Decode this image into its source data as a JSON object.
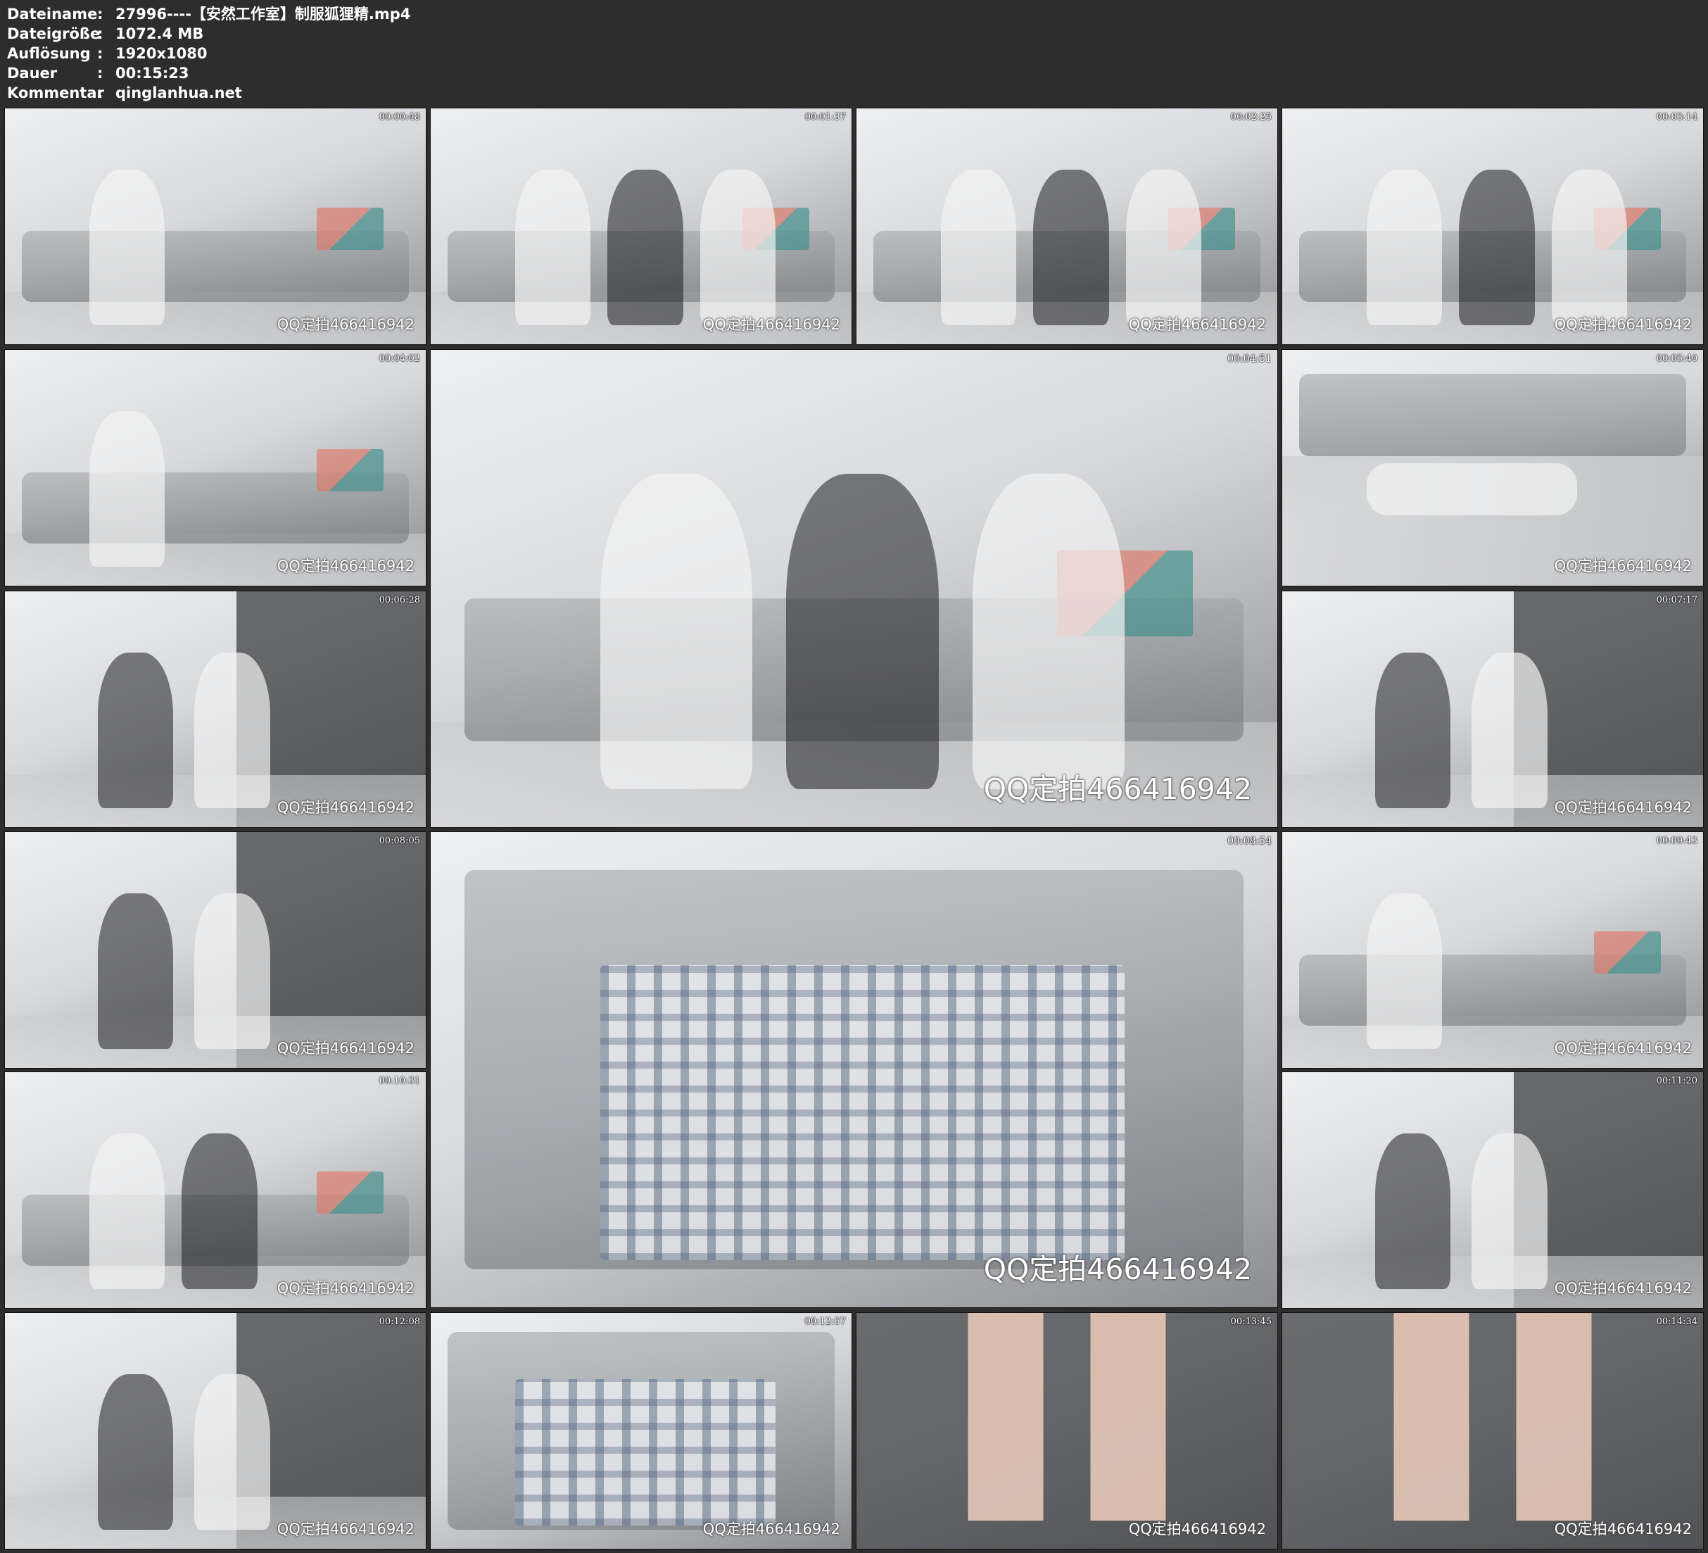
{
  "info": [
    {
      "label": "Dateiname",
      "value": "27996----【安然工作室】制服狐狸精.mp4"
    },
    {
      "label": "Dateigröße",
      "value": "1072.4 MB"
    },
    {
      "label": "Auflösung",
      "value": "1920x1080"
    },
    {
      "label": "Dauer",
      "value": "00:15:23"
    },
    {
      "label": "Kommentar",
      "value": "qinglanhua.net"
    }
  ],
  "separator": ":",
  "watermark": "QQ定拍466416942",
  "thumbnails": [
    {
      "timestamp": "00:00:48",
      "scene": "sofa-phone"
    },
    {
      "timestamp": "00:01:37",
      "scene": "sofa-three"
    },
    {
      "timestamp": "00:02:25",
      "scene": "sofa-three"
    },
    {
      "timestamp": "00:03:14",
      "scene": "sofa-three"
    },
    {
      "timestamp": "00:04:02",
      "scene": "sofa-shoe"
    },
    {
      "timestamp": "00:04:51",
      "scene": "sofa-three-big"
    },
    {
      "timestamp": "00:05:40",
      "scene": "floor"
    },
    {
      "timestamp": "00:06:28",
      "scene": "wall"
    },
    {
      "timestamp": "00:07:17",
      "scene": "wall"
    },
    {
      "timestamp": "00:08:05",
      "scene": "wall"
    },
    {
      "timestamp": "00:08:54",
      "scene": "plaid-big"
    },
    {
      "timestamp": "00:09:43",
      "scene": "sofa-gun"
    },
    {
      "timestamp": "00:10:31",
      "scene": "sofa-two"
    },
    {
      "timestamp": "00:11:20",
      "scene": "door"
    },
    {
      "timestamp": "00:12:08",
      "scene": "wall"
    },
    {
      "timestamp": "00:12:57",
      "scene": "plaid"
    },
    {
      "timestamp": "00:13:45",
      "scene": "legs"
    },
    {
      "timestamp": "00:14:34",
      "scene": "legs"
    }
  ]
}
